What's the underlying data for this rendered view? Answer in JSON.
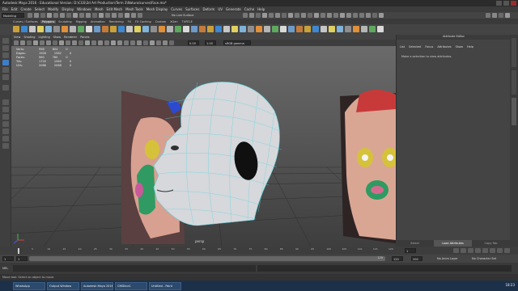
{
  "window": {
    "title": "Autodesk Maya 2016 - Educational Version: D:\\CGS\\3d Art Production\\Term 3\\Naturalcurves\\Face.ma*"
  },
  "menubar": [
    "File",
    "Edit",
    "Create",
    "Select",
    "Modify",
    "Display",
    "Windows",
    "Mesh",
    "Edit Mesh",
    "Mesh Tools",
    "Mesh Display",
    "Curves",
    "Surfaces",
    "Deform",
    "UV",
    "Generate",
    "Cache",
    "Help"
  ],
  "statusline": {
    "mode": "Modeling",
    "live_surface": "No Live Surface"
  },
  "shelf_tabs": [
    "Curves / Surfaces",
    "Polygons",
    "Sculpting",
    "Rigging",
    "Animation",
    "Rendering",
    "FX",
    "FX Caching",
    "Custom",
    "XGen",
    "TURTLE"
  ],
  "shelf_tabs_active": "Polygons",
  "panel_menu": [
    "View",
    "Shading",
    "Lighting",
    "Show",
    "Renderer",
    "Panels"
  ],
  "panel_tools": {
    "near_value": "0.00",
    "far_value": "1.00",
    "color_space": "sRGB gamma"
  },
  "hud": [
    {
      "label": "Verts:",
      "a": "998",
      "b": "804",
      "c": "0"
    },
    {
      "label": "Edges:",
      "a": "1928",
      "b": "1582",
      "c": "0"
    },
    {
      "label": "Faces:",
      "a": "960",
      "b": "780",
      "c": "0"
    },
    {
      "label": "Tris:",
      "a": "1720",
      "b": "1560",
      "c": "0"
    },
    {
      "label": "UVs:",
      "a": "2068",
      "b": "2068",
      "c": "0"
    }
  ],
  "viewport": {
    "camera_label": "persp"
  },
  "attribute_editor": {
    "header": "Attribute Editor",
    "menu": [
      "List",
      "Selected",
      "Focus",
      "Attributes",
      "Show",
      "Help"
    ],
    "message": "Make a selection to view attributes.",
    "tabs": [
      "Select",
      "Load Attributes",
      "Copy Tab"
    ],
    "active_tab": "Load Attributes"
  },
  "side_tabs": [
    "Channel Box / Layer Editor",
    "Modeling Toolkit",
    "Attribute Editor"
  ],
  "timeline": {
    "ticks": [
      "5",
      "10",
      "15",
      "20",
      "25",
      "30",
      "35",
      "40",
      "45",
      "50",
      "55",
      "60",
      "65",
      "70",
      "75",
      "80",
      "85",
      "90",
      "95",
      "100",
      "105",
      "110",
      "115",
      "120"
    ],
    "current_frame": "1"
  },
  "range": {
    "start": "1",
    "inner_start": "1",
    "inner_end": "120",
    "end_display": "120",
    "outer_end": "200",
    "anim_layer": "No Anim Layer",
    "character_set": "No Character Set"
  },
  "cmdline": {
    "lang": "MEL"
  },
  "helpline": "Move tool: Select an object to move.",
  "taskbar": {
    "items": [
      "WhatsApp",
      "Output Window",
      "Autodesk Maya 2016 -...",
      "CMDline1",
      "Untitled - Paint"
    ],
    "clock": "18:23"
  },
  "colors": {
    "maya_bg": "#444444",
    "viewport_top": "#6a6a6a",
    "viewport_bottom": "#3e3e3e",
    "wire_cyan": "#5fd4e0",
    "ref_red": "#c83a3a",
    "ref_green": "#2f9a62",
    "ref_yellow": "#d6c23a",
    "taskbar": "#1d3049",
    "active_tab": "#5a5a5a"
  }
}
